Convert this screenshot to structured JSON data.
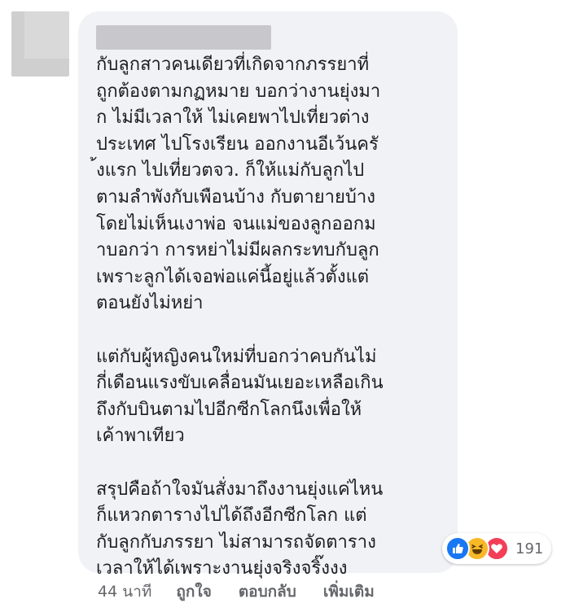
{
  "comment": {
    "text": "กับลูกสาวคนเดียวที่เกิดจากภรรยาที่\nถูกต้องตามกฏหมาย บอกว่างานยุ่งมา\nก ไม่มีเวลาให้ ไม่เคยพาไปเที่ยวต่าง\nประเทศ ไปโรงเรียน ออกงานอีเว้นครั\n้งแรก ไปเที่ยวตจว. ก็ให้แม่กับลูกไป\nตามลำพังกับเพือนบ้าง กับตายายบ้าง\nโดยไม่เห็นเงาพ่อ จนแม่ของลูกออกม\nาบอกว่า การหย่าไม่มีผลกระทบกับลูก\nเพราะลูกได้เจอพ่อแค่นี้อยู่แล้วตั้งแต่\nตอนยังไม่หย่า\n\nแต่กับผู้หญิงคนใหม่ที่บอกว่าคบกันไม่\nกี่เดือนแรงขับเคลื่อนมันเยอะเหลือเกิน\nถึงกับบินตามไปอีกซีกโลกนึงเพื่อให้\nเค้าพาเทียว\n\nสรุปคือถ้าใจมันสั่งมาถึงงานยุ่งแค่ไหน\nก็แหวกตารางไปได้ถึงอีกซีกโลก แต่\nกับลูกกับภรรยา ไม่สามารถจัดตาราง\nเวลาให้ได้เพราะงานยุ่งจริงจริ๊งงง"
  },
  "reactions": {
    "types": [
      "like-icon",
      "haha-icon",
      "love-icon"
    ],
    "count": "191"
  },
  "actions": {
    "timestamp": "44 นาที",
    "like_label": "ถูกใจ",
    "reply_label": "ตอบกลับ",
    "more_label": "เพิ่มเติม"
  },
  "colors": {
    "bubble": "#f1f2f6",
    "text": "#1c1e21",
    "meta_text": "#65676b",
    "like": "#1877f2",
    "haha": "#f7b928",
    "love": "#f33e58"
  }
}
